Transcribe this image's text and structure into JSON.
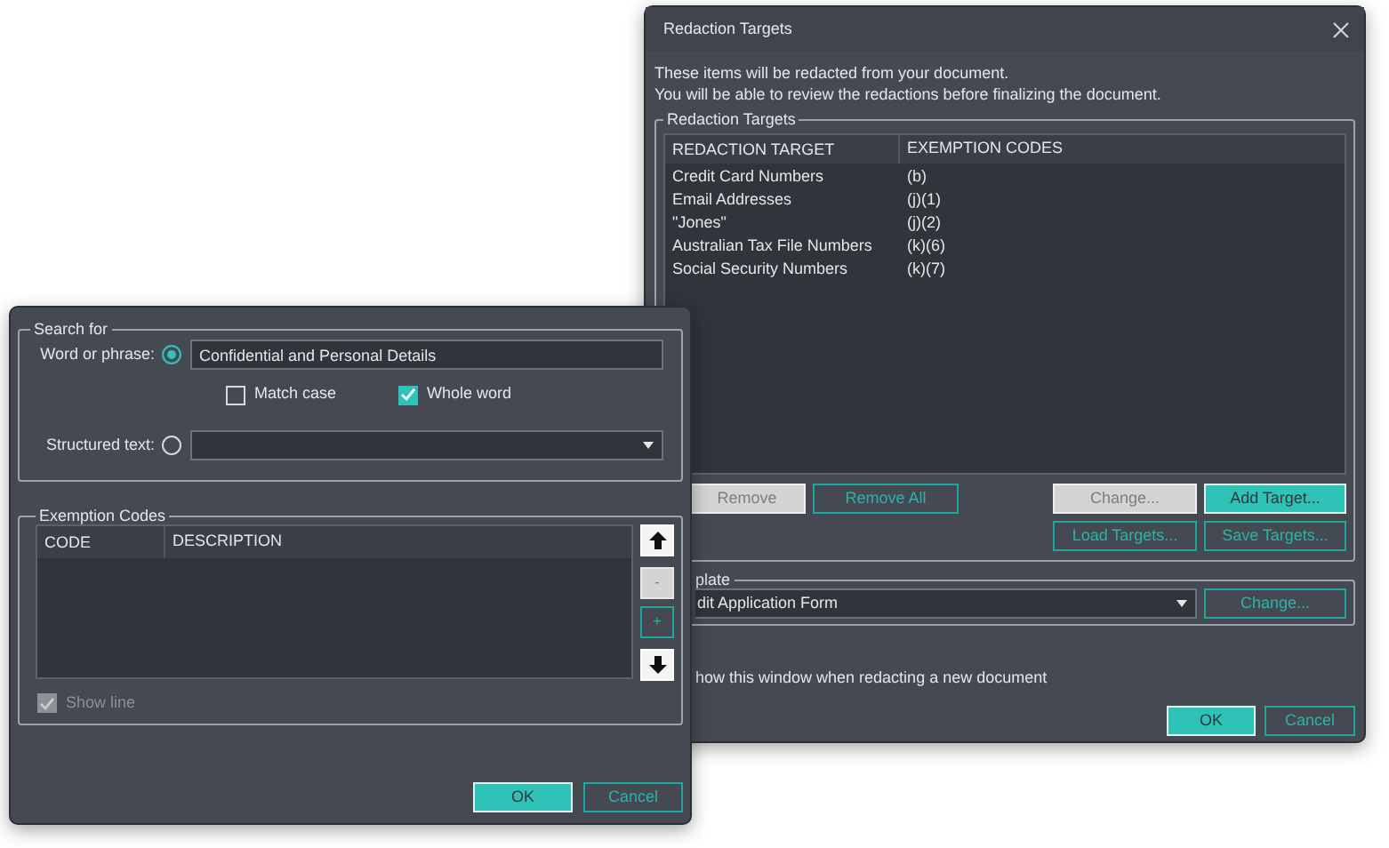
{
  "redaction_dialog": {
    "title": "Redaction Targets",
    "intro": [
      "These items will be redacted from your document.",
      "You will be able to review the redactions before finalizing the document."
    ],
    "targets": {
      "legend": "Redaction Targets",
      "columns": [
        "REDACTION TARGET",
        "EXEMPTION CODES"
      ],
      "rows": [
        {
          "target": "Credit Card Numbers",
          "codes": "(b)"
        },
        {
          "target": "Email Addresses",
          "codes": "(j)(1)"
        },
        {
          "target": "\"Jones\"",
          "codes": "(j)(2)"
        },
        {
          "target": "Australian Tax File Numbers",
          "codes": "(k)(6)"
        },
        {
          "target": "Social Security Numbers",
          "codes": "(k)(7)"
        }
      ]
    },
    "target_buttons": [
      {
        "label": "Remove",
        "kind": "light"
      },
      {
        "label": "Remove All",
        "kind": "outline"
      },
      {
        "label": "Change...",
        "kind": "light"
      },
      {
        "label": "Add Target...",
        "kind": "primary"
      },
      {
        "label": "Load Targets...",
        "kind": "outline"
      },
      {
        "label": "Save Targets...",
        "kind": "outline"
      }
    ],
    "template": {
      "legend": "plate",
      "value": "dit Application Form",
      "button": {
        "label": "Change...",
        "kind": "outline"
      }
    },
    "show_option": "how this window when redacting a new document",
    "footer_buttons": [
      {
        "label": "OK",
        "kind": "primary"
      },
      {
        "label": "Cancel",
        "kind": "outline"
      }
    ]
  },
  "search_dialog": {
    "search_for": {
      "legend": "Search for",
      "options": [
        {
          "kind": "phrase",
          "label": "Word or phrase:",
          "selected": true,
          "value": "Confidential and Personal Details"
        },
        {
          "kind": "structured",
          "label": "Structured text:",
          "selected": false
        }
      ],
      "checks": [
        {
          "label": "Match case",
          "checked": false
        },
        {
          "label": "Whole word",
          "checked": true
        }
      ]
    },
    "exemption_codes": {
      "legend": "Exemption Codes",
      "columns": [
        "CODE",
        "DESCRIPTION"
      ],
      "side_buttons": [
        {
          "kind": "up"
        },
        {
          "kind": "minus",
          "label": "-"
        },
        {
          "kind": "plus",
          "label": "+"
        },
        {
          "kind": "down"
        }
      ],
      "show_line": {
        "label": "Show line",
        "checked": true,
        "disabled": true
      }
    },
    "footer_buttons": [
      {
        "label": "OK",
        "kind": "primary"
      },
      {
        "label": "Cancel",
        "kind": "outline"
      }
    ]
  }
}
